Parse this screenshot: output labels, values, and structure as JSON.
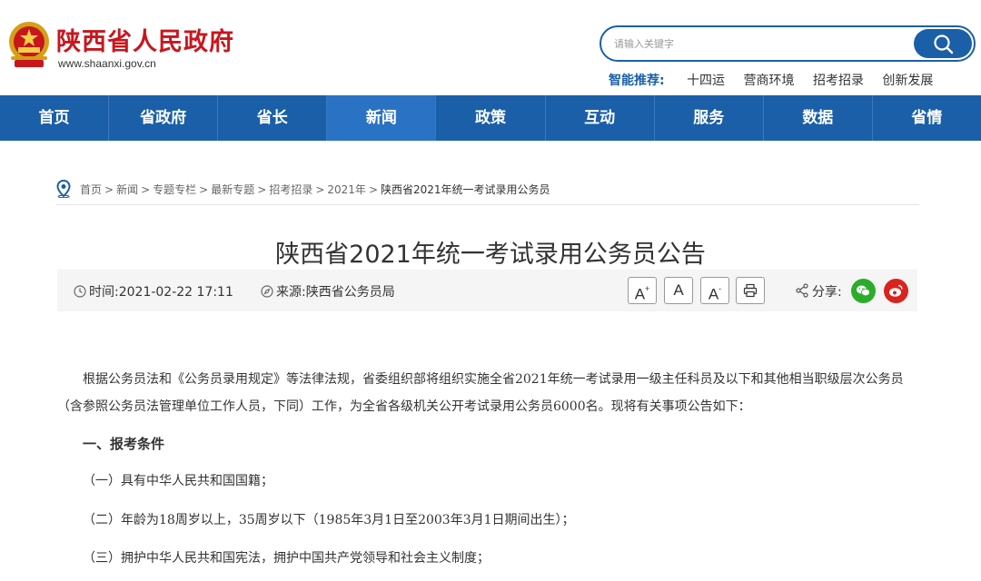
{
  "header": {
    "site_title": "陕西省人民政府",
    "site_url": "www.shaanxi.gov.cn",
    "search_placeholder": "请输入关键字",
    "smart_label": "智能推荐:",
    "smart_items": [
      "十四运",
      "营商环境",
      "招考招录",
      "创新发展"
    ]
  },
  "nav": {
    "items": [
      "首页",
      "省政府",
      "省长",
      "新闻",
      "政策",
      "互动",
      "服务",
      "数据",
      "省情"
    ],
    "active_index": 3
  },
  "breadcrumb": {
    "links": [
      "首页",
      "新闻",
      "专题专栏",
      "最新专题",
      "招考招录",
      "2021年"
    ],
    "current": "陕西省2021年统一考试录用公务员",
    "separator": ">"
  },
  "article": {
    "title": "陕西省2021年统一考试录用公务员公告",
    "time_label": "时间:",
    "time_value": "2021-02-22 17:11",
    "source_label": "来源:",
    "source_value": "陕西省公务员局",
    "font_buttons": [
      "A",
      "A",
      "A"
    ],
    "share_label": "分享:",
    "paragraphs": [
      "根据公务员法和《公务员录用规定》等法律法规，省委组织部将组织实施全省2021年统一考试录用一级主任科员及以下和其他相当职级层次公务员",
      "（含参照公务员法管理单位工作人员，下同）工作，为全省各级机关公开考试录用公务员6000名。现将有关事项公告如下：",
      "一、报考条件",
      "（一）具有中华人民共和国国籍；",
      "（二）年龄为18周岁以上，35周岁以下（1985年3月1日至2003年3月1日期间出生）；",
      "（三）拥护中华人民共和国宪法，拥护中国共产党领导和社会主义制度；"
    ]
  },
  "colors": {
    "brand_red": "#c8161d",
    "nav_blue": "#1b5fa8",
    "wechat_green": "#2bad2b",
    "weibo_red": "#d9231f"
  }
}
